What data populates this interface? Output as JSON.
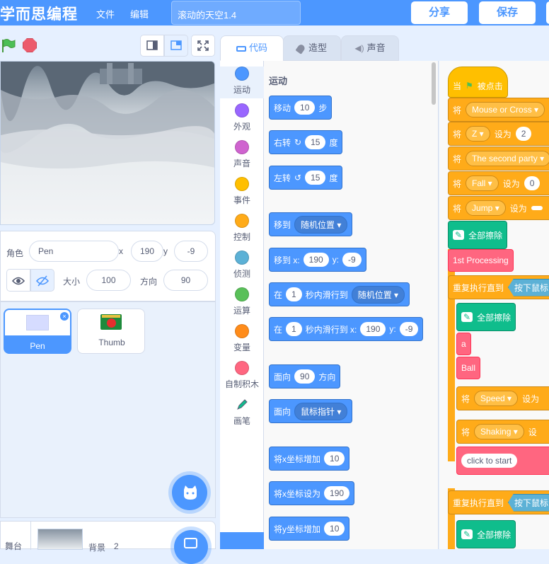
{
  "menubar": {
    "logo": "学而思编程",
    "file": "文件",
    "edit": "编辑",
    "project_title": "滚动的天空1.4",
    "share": "分享",
    "save": "保存"
  },
  "sprite": {
    "name_label": "角色",
    "name": "Pen",
    "x_label": "x",
    "x": "190",
    "y_label": "y",
    "y": "-9",
    "size_label": "大小",
    "size": "100",
    "dir_label": "方向",
    "dir": "90"
  },
  "sprites": [
    {
      "name": "Pen"
    },
    {
      "name": "Thumb"
    }
  ],
  "stagepanel": {
    "label": "舞台",
    "backdrop_label": "背景",
    "backdrop_count": "2"
  },
  "tabs": {
    "code": "代码",
    "costumes": "造型",
    "sounds": "声音"
  },
  "categories": [
    {
      "label": "运动",
      "color": "#4c97ff"
    },
    {
      "label": "外观",
      "color": "#9966ff"
    },
    {
      "label": "声音",
      "color": "#cf63cf"
    },
    {
      "label": "事件",
      "color": "#ffbf00"
    },
    {
      "label": "控制",
      "color": "#ffab19"
    },
    {
      "label": "侦测",
      "color": "#5cb1d6"
    },
    {
      "label": "运算",
      "color": "#59c059"
    },
    {
      "label": "变量",
      "color": "#ff8c1a"
    },
    {
      "label": "自制积木",
      "color": "#ff6680"
    },
    {
      "label": "画笔",
      "color": "#0fbd8c"
    }
  ],
  "palette": {
    "heading": "运动",
    "move": {
      "a": "移动",
      "v": "10",
      "b": "步"
    },
    "turn_right": {
      "a": "右转",
      "v": "15",
      "b": "度"
    },
    "turn_left": {
      "a": "左转",
      "v": "15",
      "b": "度"
    },
    "goto": {
      "a": "移到",
      "d": "随机位置"
    },
    "goto_xy": {
      "a": "移到 x:",
      "x": "190",
      "yl": "y:",
      "y": "-9"
    },
    "glide": {
      "a": "在",
      "v": "1",
      "b": "秒内滑行到",
      "d": "随机位置"
    },
    "glide_xy": {
      "a": "在",
      "v": "1",
      "b": "秒内滑行到 x:",
      "x": "190",
      "yl": "y:",
      "y": "-9"
    },
    "point_dir": {
      "a": "面向",
      "v": "90",
      "b": "方向"
    },
    "point_towards": {
      "a": "面向",
      "d": "鼠标指针"
    },
    "change_x": {
      "a": "将x坐标增加",
      "v": "10"
    },
    "set_x": {
      "a": "将x坐标设为",
      "v": "190"
    },
    "change_y": {
      "a": "将y坐标增加",
      "v": "10"
    }
  },
  "script": {
    "hat": {
      "a": "当",
      "b": "被点击"
    },
    "b1": {
      "a": "将",
      "d": "Mouse or Cross"
    },
    "b2": {
      "a": "将",
      "d": "Z",
      "b": "设为",
      "v": "2"
    },
    "b3": {
      "a": "将",
      "d": "The second party"
    },
    "b4": {
      "a": "将",
      "d": "Fall",
      "b": "设为",
      "v": "0"
    },
    "b5": {
      "a": "将",
      "d": "Jump",
      "b": "设为"
    },
    "clear": "全部擦除",
    "proc": "1st Processing",
    "repeat_until": "重复执行直到",
    "cond": "按下鼠标",
    "clear2": "全部擦除",
    "call_a": "a",
    "call_ball": "Ball",
    "b6": {
      "a": "将",
      "d": "Speed",
      "b": "设为"
    },
    "b7": {
      "a": "将",
      "d": "Shaking",
      "b": "设"
    },
    "click_to_start": "click to start",
    "repeat_until2": "重复执行直到",
    "cond2": "按下鼠标",
    "clear3": "全部擦除"
  }
}
